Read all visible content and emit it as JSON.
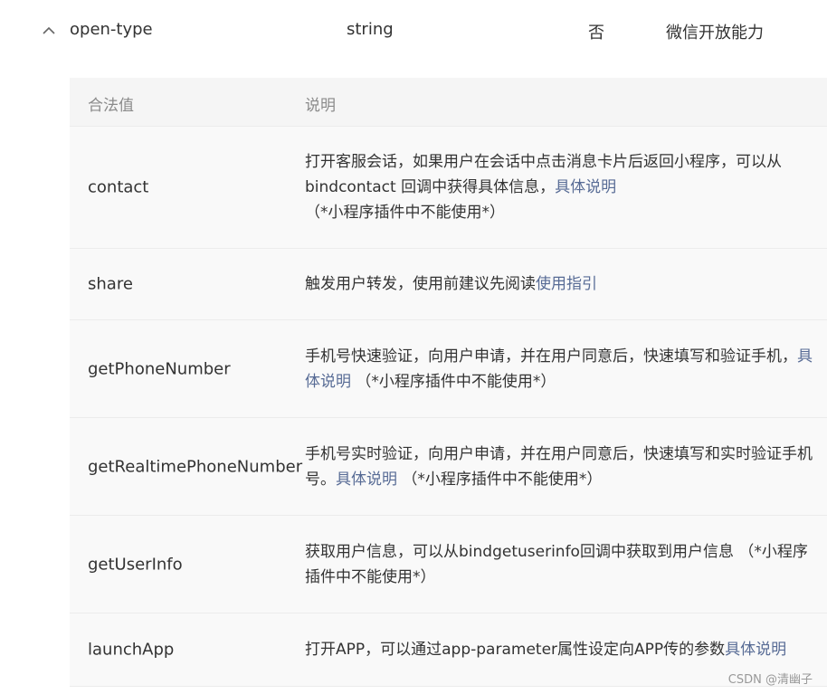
{
  "prop": {
    "name": "open-type",
    "type": "string",
    "required": "否",
    "description": "微信开放能力"
  },
  "table": {
    "headers": [
      "合法值",
      "说明"
    ],
    "rows": [
      {
        "value": "contact",
        "desc_text": "打开客服会话，如果用户在会话中点击消息卡片后返回小程序，可以从bindcontact 回调中获得具体信息，",
        "link": "具体说明",
        "desc_suffix": " （*小程序插件中不能使用*）"
      },
      {
        "value": "share",
        "desc_text": "触发用户转发，使用前建议先阅读",
        "link": "使用指引",
        "desc_suffix": ""
      },
      {
        "value": "getPhoneNumber",
        "desc_text": "手机号快速验证，向用户申请，并在用户同意后，快速填写和验证手机，",
        "link": "具体说明",
        "desc_suffix": " （*小程序插件中不能使用*）"
      },
      {
        "value": "getRealtimePhoneNumber",
        "desc_text": "手机号实时验证，向用户申请，并在用户同意后，快速填写和实时验证手机号。",
        "link": "具体说明",
        "desc_suffix": " （*小程序插件中不能使用*）"
      },
      {
        "value": "getUserInfo",
        "desc_text": "获取用户信息，可以从bindgetuserinfo回调中获取到用户信息 （*小程序插件中不能使用*）",
        "link": "",
        "desc_suffix": ""
      },
      {
        "value": "launchApp",
        "desc_text": "打开APP，可以通过app-parameter属性设定向APP传的参数",
        "link": "具体说明",
        "desc_suffix": ""
      }
    ]
  },
  "watermark": "CSDN @清幽子",
  "colors": {
    "link": "#576b95",
    "header_text": "#8a8a8a",
    "table_bg": "#f7f7f7"
  }
}
